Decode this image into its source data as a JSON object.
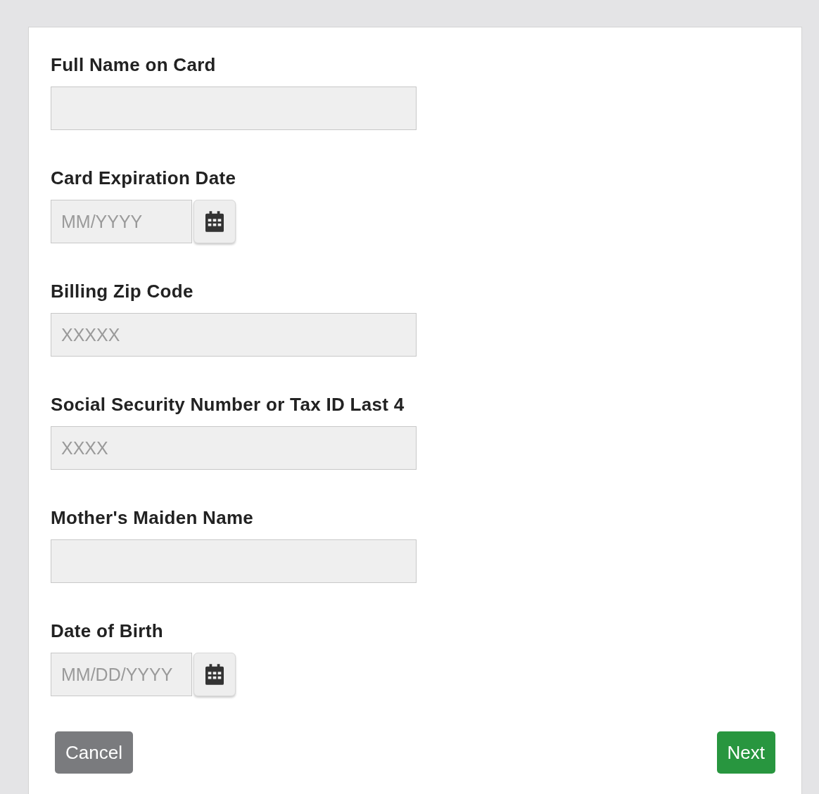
{
  "fields": [
    {
      "kind": "text",
      "label": "Full Name on Card"
    },
    {
      "kind": "date",
      "label": "Card Expiration Date",
      "placeholder": "MM/YYYY"
    },
    {
      "kind": "text",
      "label": "Billing Zip Code",
      "placeholder": "XXXXX"
    },
    {
      "kind": "text",
      "label": "Social Security Number or Tax ID Last 4",
      "placeholder": "XXXX"
    },
    {
      "kind": "text",
      "label": "Mother's Maiden Name"
    },
    {
      "kind": "date",
      "label": "Date of Birth",
      "placeholder": "MM/DD/YYYY"
    }
  ],
  "buttons": [
    {
      "kind": "secondary",
      "label": "Cancel"
    },
    {
      "kind": "primary",
      "label": "Next"
    }
  ]
}
